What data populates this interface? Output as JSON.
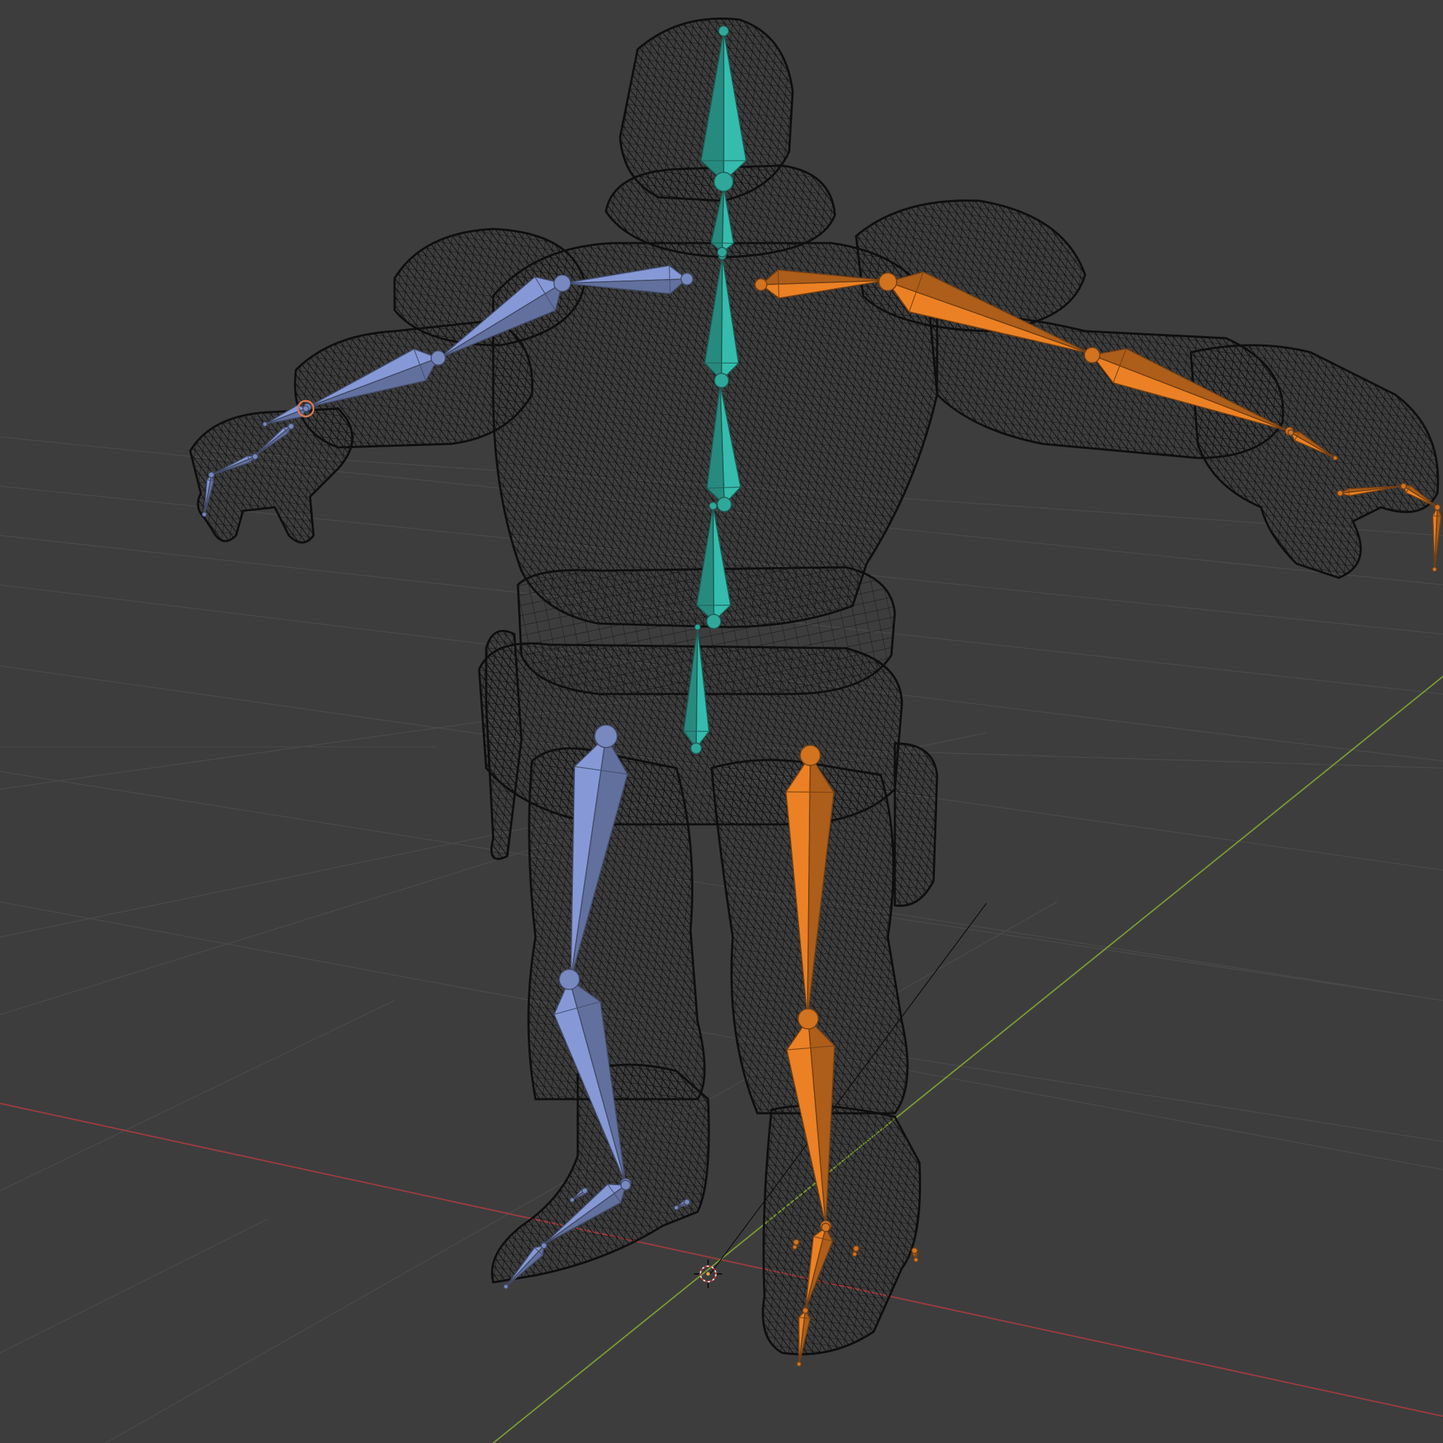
{
  "viewport": {
    "background": "#3d3d3d",
    "mode": "wireframe",
    "grid": true
  },
  "colors": {
    "grid_line": "#4a4a4a",
    "x_axis": "#9c3c3c",
    "y_axis": "#7a9a33",
    "wireframe": "#0f0f0f",
    "spine_bones": "#2fa89a",
    "left_side_bones": "#7889bf",
    "right_side_bones": "#d27320",
    "selected_outline": "#e07850"
  },
  "armature": {
    "bone_groups": [
      "spine",
      "left-arm",
      "right-arm",
      "left-leg",
      "right-leg"
    ]
  },
  "scene": {
    "origin_icon": "3d-cursor-icon"
  }
}
